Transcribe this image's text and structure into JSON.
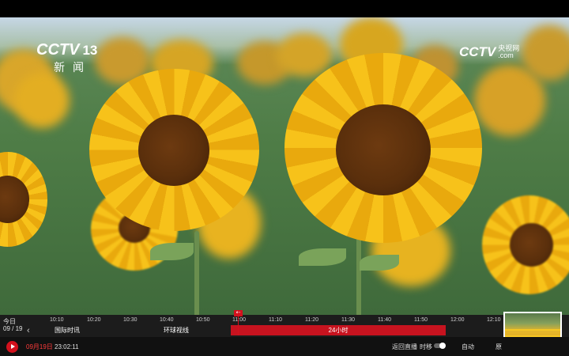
{
  "channel": {
    "logo_left_text": "CCTV",
    "logo_left_number": "13",
    "logo_left_sub": "新闻",
    "logo_right_text": "CCTV",
    "logo_right_small_1": "央视网",
    "logo_right_small_2": ".com"
  },
  "timeline": {
    "today_label": "今日",
    "today_date": "09 / 19",
    "ticks": [
      "10:10",
      "10:20",
      "10:30",
      "10:40",
      "10:50",
      "11:00",
      "11:10",
      "11:20",
      "11:30",
      "11:40",
      "11:50",
      "12:00",
      "12:10"
    ],
    "segments": [
      {
        "label": "国际时讯",
        "active": false
      },
      {
        "label": "环球视线",
        "active": false
      },
      {
        "label": "24小时",
        "active": true
      }
    ]
  },
  "bottom": {
    "date": "09月19日",
    "time": "23:02:11",
    "back_to_live": "返回直播",
    "timeshift": "时移",
    "auto": "自动",
    "fullscreen": "原"
  },
  "colors": {
    "accent": "#d3111d",
    "segment_active": "#c7131f"
  },
  "icons": {
    "play": "play-icon",
    "back_arrow": "chevron-left-icon",
    "marker": "back-arrow-icon"
  }
}
